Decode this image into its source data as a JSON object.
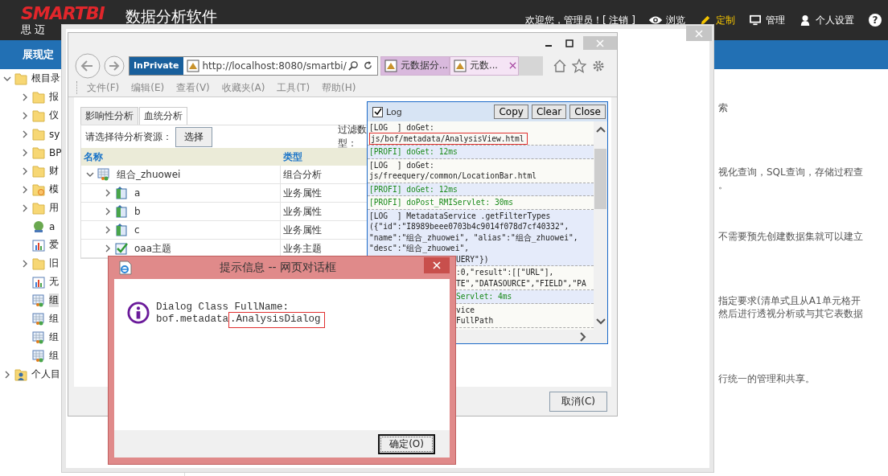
{
  "app": {
    "logo": "SMARTBI",
    "logo_sub": "思 迈",
    "title": "数据分析软件",
    "welcome": "欢迎您，管理员！[ 注销 ]",
    "help": "?",
    "section": "展现定",
    "nav": [
      {
        "label": "浏览",
        "kind": "eye",
        "selected": false
      },
      {
        "label": "定制",
        "kind": "pencil",
        "selected": true
      },
      {
        "label": "管理",
        "kind": "monitor",
        "selected": false
      },
      {
        "label": "个人设置",
        "kind": "person",
        "selected": false
      }
    ]
  },
  "sidebar": {
    "tree": [
      {
        "label": "根目录",
        "kind": "folder",
        "expandable": true,
        "expanded": true,
        "selected": false,
        "children": [
          {
            "label": "报",
            "kind": "folder",
            "expandable": true,
            "expanded": false,
            "selected": false
          },
          {
            "label": "仪",
            "kind": "folder",
            "expandable": true,
            "expanded": false,
            "selected": false
          },
          {
            "label": "sy",
            "kind": "folder",
            "expandable": true,
            "expanded": false,
            "selected": false
          },
          {
            "label": "BP",
            "kind": "folder",
            "expandable": true,
            "expanded": false,
            "selected": false
          },
          {
            "label": "财",
            "kind": "folder",
            "expandable": true,
            "expanded": false,
            "selected": false
          },
          {
            "label": "模",
            "kind": "locked-folder",
            "expandable": true,
            "expanded": false,
            "selected": false
          },
          {
            "label": "用",
            "kind": "folder",
            "expandable": true,
            "expanded": false,
            "selected": false
          },
          {
            "label": "a",
            "kind": "globe",
            "expandable": false,
            "selected": false
          },
          {
            "label": "爱",
            "kind": "chart",
            "expandable": false,
            "selected": false
          },
          {
            "label": "旧",
            "kind": "folder",
            "expandable": true,
            "expanded": false,
            "selected": false
          },
          {
            "label": "无",
            "kind": "chart",
            "expandable": false,
            "selected": false
          },
          {
            "label": "组",
            "kind": "combo",
            "expandable": false,
            "selected": true
          },
          {
            "label": "组",
            "kind": "combo",
            "expandable": false,
            "selected": false
          },
          {
            "label": "组",
            "kind": "combo",
            "expandable": false,
            "selected": false
          },
          {
            "label": "组",
            "kind": "combo",
            "expandable": false,
            "selected": false
          }
        ]
      },
      {
        "label": "个人目",
        "kind": "user",
        "expandable": true,
        "expanded": false,
        "selected": false
      }
    ]
  },
  "content_fragments": [
    [
      "索"
    ],
    [
      "视化查询，SQL查询，存储过程查",
      "。"
    ],
    [
      "不需要预先创建数据集就可以建立"
    ],
    [
      "指定要求(清单式且从A1单元格开",
      "然后进行透视分析或与其它表数据"
    ],
    [
      "行统一的管理和共享。"
    ]
  ],
  "browser": {
    "inprivate": "InPrivate",
    "url": "http://localhost:8080/smartbi/",
    "tabs": [
      {
        "label": "元数据分...",
        "selected": true
      },
      {
        "label": "元数...",
        "selected": false
      }
    ],
    "menu": [
      {
        "label": "文件(F)",
        "disabled": true
      },
      {
        "label": "编辑(E)",
        "disabled": true
      },
      {
        "label": "查看(V)",
        "disabled": true
      },
      {
        "label": "收藏夹(A)",
        "disabled": true
      },
      {
        "label": "工具(T)",
        "disabled": true
      },
      {
        "label": "帮助(H)",
        "disabled": true
      }
    ]
  },
  "page": {
    "tabs": [
      {
        "label": "影响性分析",
        "selected": false
      },
      {
        "label": "血统分析",
        "selected": true
      }
    ],
    "resource_label": "请选择待分析资源：",
    "choose_button": "选择",
    "filter_label": [
      "过滤数",
      "型："
    ],
    "columns": [
      "名称",
      "类型"
    ],
    "rows": [
      {
        "name": "组合_zhuowei",
        "type": "组合分析",
        "kind": "combo",
        "expanded": true,
        "children": [
          {
            "name": "a",
            "type": "业务属性",
            "kind": "attribute",
            "expanded": false
          },
          {
            "name": "b",
            "type": "业务属性",
            "kind": "attribute",
            "expanded": false
          },
          {
            "name": "c",
            "type": "业务属性",
            "kind": "attribute",
            "expanded": false
          },
          {
            "name": "oaa主题",
            "type": "业务主题",
            "kind": "subject",
            "expanded": false
          }
        ]
      }
    ],
    "cancel_button": "取消(C)"
  },
  "log": {
    "enabled": true,
    "title": "Log",
    "buttons": [
      "Copy",
      "Clear",
      "Close"
    ],
    "entries": [
      {
        "kind": "log",
        "lines": [
          {
            "text": "[LOG  ] doGet:",
            "highlighted": false,
            "kind": "full"
          },
          {
            "text": "js/bof/metadata/AnalysisView.html",
            "highlighted": true,
            "kind": "full"
          }
        ]
      },
      {
        "kind": "profi",
        "lines": [
          {
            "text": "[PROFI] doGet: 12ms",
            "highlighted": false,
            "kind": "full"
          }
        ]
      },
      {
        "kind": "log",
        "lines": [
          {
            "text": "[LOG  ] doGet:",
            "highlighted": false,
            "kind": "full"
          },
          {
            "text": "js/freequery/common/LocationBar.html",
            "highlighted": false,
            "kind": "full"
          }
        ]
      },
      {
        "kind": "profi",
        "lines": [
          {
            "text": "[PROFI] doGet: 12ms",
            "highlighted": false,
            "kind": "full"
          }
        ]
      },
      {
        "kind": "profi",
        "lines": [
          {
            "text": "[PROFI] doPost_RMIServlet: 30ms",
            "highlighted": false,
            "kind": "full"
          }
        ]
      },
      {
        "kind": "log",
        "lines": [
          {
            "text": "[LOG  ] MetadataService .getFilterTypes",
            "highlighted": false,
            "kind": "full"
          },
          {
            "text": "({\"id\":\"I8989beee0703b4c9014f078d7cf40332\",",
            "highlighted": false,
            "kind": "full"
          },
          {
            "text": "\"name\":\"组合_zhuowei\", \"alias\":\"组合_zhuowei\",",
            "highlighted": false,
            "kind": "full"
          },
          {
            "text": "\"desc\":\"组合_zhuowei\",",
            "highlighted": false,
            "kind": "full"
          },
          {
            "text": "UERY\"})",
            "highlighted": false,
            "kind": "tail"
          }
        ]
      },
      {
        "kind": "log",
        "lines": [
          {
            "text": ":0,\"result\":[[\"URL\"],",
            "highlighted": false,
            "kind": "tail"
          },
          {
            "text": "TE\",\"DATASOURCE\",\"FIELD\",\"PA",
            "highlighted": false,
            "kind": "tail"
          }
        ]
      },
      {
        "kind": "profi",
        "lines": [
          {
            "text": "Servlet: 4ms",
            "highlighted": false,
            "kind": "tail"
          }
        ]
      },
      {
        "kind": "log",
        "lines": [
          {
            "text": "vice",
            "highlighted": false,
            "kind": "tail"
          },
          {
            "text": "FullPath",
            "highlighted": false,
            "kind": "tail"
          }
        ]
      }
    ]
  },
  "alert": {
    "title": "提示信息 -- 网页对话框",
    "message": [
      [
        {
          "text": "Dialog Class FullName:",
          "highlighted": false
        }
      ],
      [
        {
          "text": "bof.metadata",
          "highlighted": false
        },
        {
          "text": ".AnalysisDialog",
          "highlighted": true
        }
      ]
    ],
    "ok_button": "确定(O)"
  }
}
